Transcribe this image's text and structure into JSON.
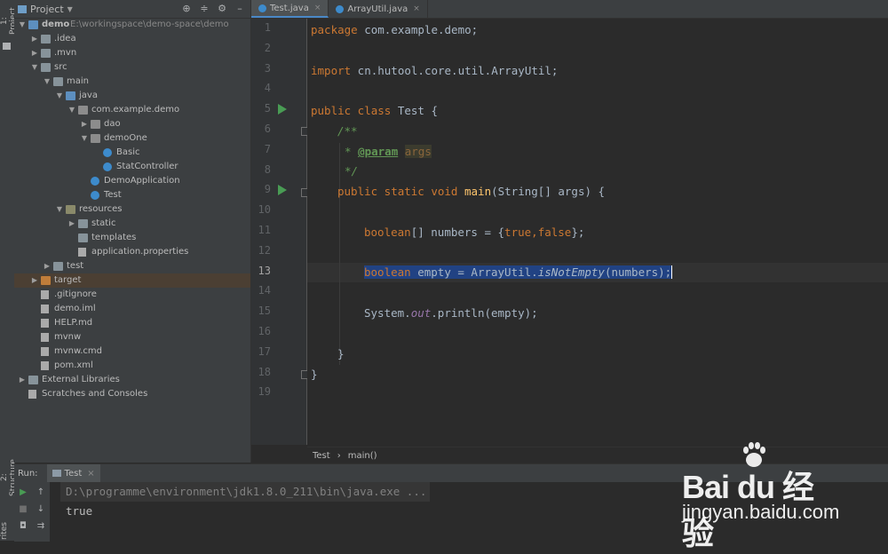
{
  "left_strip": {
    "project_tab": "1: Project",
    "structure_tab": "2: Structure",
    "favorites_tab": "rites"
  },
  "project_panel": {
    "title": "Project",
    "tree": [
      {
        "depth": 0,
        "arrow": "▼",
        "icon": "folder-module",
        "label": "demo",
        "extra": "E:\\workingspace\\demo-space\\demo",
        "bold": true
      },
      {
        "depth": 1,
        "arrow": "▶",
        "icon": "folder",
        "label": ".idea"
      },
      {
        "depth": 1,
        "arrow": "▶",
        "icon": "folder",
        "label": ".mvn"
      },
      {
        "depth": 1,
        "arrow": "▼",
        "icon": "folder",
        "label": "src"
      },
      {
        "depth": 2,
        "arrow": "▼",
        "icon": "folder",
        "label": "main"
      },
      {
        "depth": 3,
        "arrow": "▼",
        "icon": "folder-blue",
        "label": "java"
      },
      {
        "depth": 4,
        "arrow": "▼",
        "icon": "package",
        "label": "com.example.demo"
      },
      {
        "depth": 5,
        "arrow": "▶",
        "icon": "package",
        "label": "dao"
      },
      {
        "depth": 5,
        "arrow": "▼",
        "icon": "package",
        "label": "demoOne"
      },
      {
        "depth": 6,
        "arrow": "",
        "icon": "class",
        "label": "Basic"
      },
      {
        "depth": 6,
        "arrow": "",
        "icon": "class",
        "label": "StatController"
      },
      {
        "depth": 5,
        "arrow": "",
        "icon": "class",
        "label": "DemoApplication"
      },
      {
        "depth": 5,
        "arrow": "",
        "icon": "class",
        "label": "Test"
      },
      {
        "depth": 3,
        "arrow": "▼",
        "icon": "folder-res",
        "label": "resources"
      },
      {
        "depth": 4,
        "arrow": "▶",
        "icon": "folder",
        "label": "static"
      },
      {
        "depth": 4,
        "arrow": "",
        "icon": "folder",
        "label": "templates"
      },
      {
        "depth": 4,
        "arrow": "",
        "icon": "properties",
        "label": "application.properties"
      },
      {
        "depth": 2,
        "arrow": "▶",
        "icon": "folder",
        "label": "test"
      },
      {
        "depth": 1,
        "arrow": "▶",
        "icon": "folder-orange",
        "label": "target",
        "selected": true
      },
      {
        "depth": 1,
        "arrow": "",
        "icon": "file",
        "label": ".gitignore"
      },
      {
        "depth": 1,
        "arrow": "",
        "icon": "file",
        "label": "demo.iml"
      },
      {
        "depth": 1,
        "arrow": "",
        "icon": "file",
        "label": "HELP.md"
      },
      {
        "depth": 1,
        "arrow": "",
        "icon": "file",
        "label": "mvnw"
      },
      {
        "depth": 1,
        "arrow": "",
        "icon": "file",
        "label": "mvnw.cmd"
      },
      {
        "depth": 1,
        "arrow": "",
        "icon": "maven",
        "label": "pom.xml"
      },
      {
        "depth": 0,
        "arrow": "▶",
        "icon": "libraries",
        "label": "External Libraries"
      },
      {
        "depth": 0,
        "arrow": "",
        "icon": "scratches",
        "label": "Scratches and Consoles"
      }
    ]
  },
  "editor": {
    "tabs": [
      {
        "label": "Test.java",
        "active": true,
        "close": "×"
      },
      {
        "label": "ArrayUtil.java",
        "active": false,
        "close": "×"
      }
    ],
    "line_numbers": [
      "1",
      "2",
      "3",
      "4",
      "5",
      "6",
      "7",
      "8",
      "9",
      "10",
      "11",
      "12",
      "13",
      "14",
      "15",
      "16",
      "17",
      "18",
      "19"
    ],
    "current_line": "13",
    "breadcrumb": {
      "class": "Test",
      "sep": "›",
      "method": "main()"
    }
  },
  "code_tokens": {
    "l1_kw": "package",
    "l1_rest": " com.example.demo;",
    "l3_kw": "import",
    "l3_rest": " cn.hutool.core.util.ArrayUtil;",
    "l5_kw": "public class",
    "l5_rest": " Test {",
    "l6_doc": "/**",
    "l7_star": "* ",
    "l7_tag": "@param",
    "l7_param": "args",
    "l8_doc": "*/",
    "l9_kw": "public static void",
    "l9_fn": "main",
    "l9_rest": "(String[] args) {",
    "l11_kw": "boolean",
    "l11_mid": "[] numbers = {",
    "l11_v1": "true",
    "l11_comma": ",",
    "l11_v2": "false",
    "l11_end": "};",
    "l13_kw": "boolean",
    "l13_mid": " empty = ArrayUtil.",
    "l13_st": "isNotEmpty",
    "l13_end": "(numbers);",
    "l15_a": "System.",
    "l15_out": "out",
    "l15_b": ".println(empty);",
    "l17": "}",
    "l18": "}"
  },
  "run_panel": {
    "label": "Run:",
    "tab": "Test",
    "tab_close": "×",
    "console": [
      "D:\\programme\\environment\\jdk1.8.0_211\\bin\\java.exe ...",
      "true"
    ]
  },
  "watermark": {
    "main": "Bai du 经验",
    "sub": "jingyan.baidu.com"
  }
}
